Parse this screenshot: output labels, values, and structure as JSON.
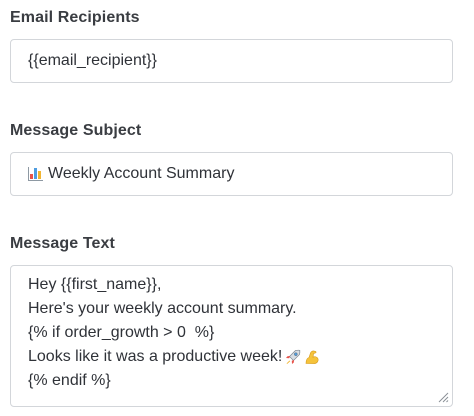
{
  "fields": {
    "recipients": {
      "label": "Email Recipients",
      "value": "{{email_recipient}}"
    },
    "subject": {
      "label": "Message Subject",
      "icon": "bar-chart-icon",
      "value": "Weekly Account Summary"
    },
    "text": {
      "label": "Message Text",
      "lines": [
        "Hey {{first_name}},",
        "Here's your weekly account summary.",
        "{% if order_growth > 0  %}",
        "Looks like it was a productive week!",
        "{% endif %}"
      ],
      "line4_icons": [
        "rocket-icon",
        "flexed-biceps-icon"
      ]
    }
  },
  "colors": {
    "label": "#3a3d42",
    "text": "#2f3238",
    "border": "#d3d6da",
    "chart_bars": [
      "#e8534a",
      "#4f9de0",
      "#f2b632"
    ]
  }
}
